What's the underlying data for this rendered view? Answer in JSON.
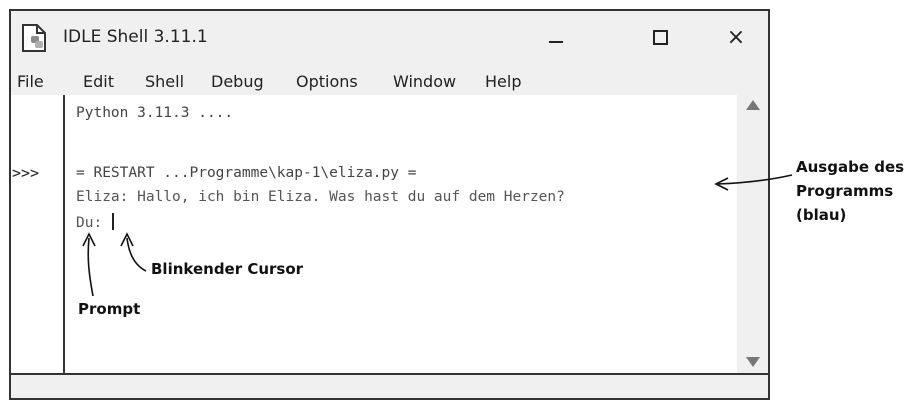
{
  "window": {
    "title": "IDLE Shell 3.11.1",
    "controls": {
      "minimize": "minimize-icon",
      "maximize": "maximize-icon",
      "close": "×"
    }
  },
  "menu": [
    "File",
    "Edit",
    "Shell",
    "Debug",
    "Options",
    "Window",
    "Help"
  ],
  "gutter": {
    "prompt": ">>>"
  },
  "shell": {
    "banner": "Python 3.11.3 ....",
    "restart": "= RESTART ...Programme\\kap-1\\eliza.py =",
    "output": "Eliza: Hallo, ich bin Eliza. Was hast du auf dem Herzen?",
    "input_prefix": "Du: "
  },
  "annotations": {
    "output": [
      "Ausgabe des",
      "Programms",
      "(blau)"
    ],
    "cursor": "Blinkender Cursor",
    "prompt": "Prompt"
  }
}
